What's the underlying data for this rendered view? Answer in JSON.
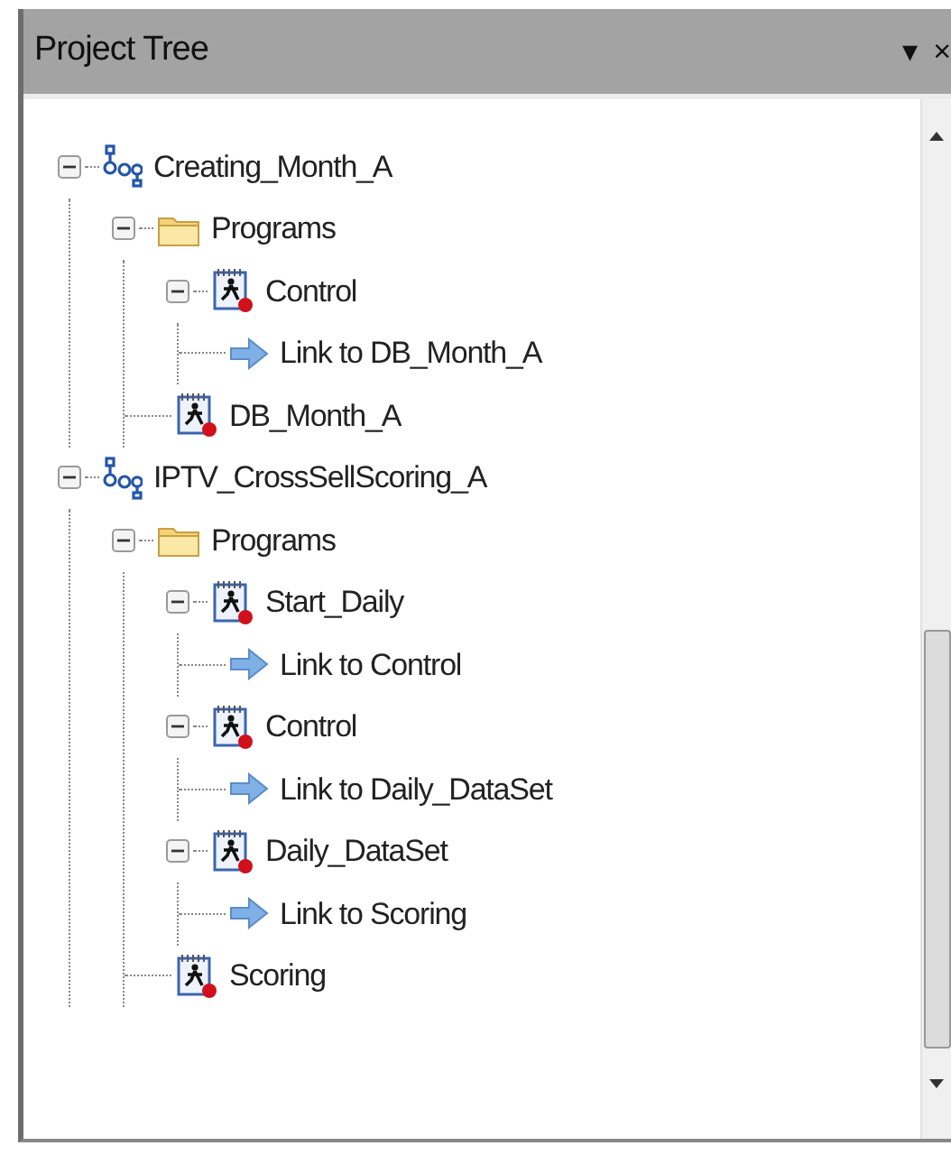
{
  "panel": {
    "title": "Project Tree",
    "menu_glyph": "▾",
    "close_glyph": "×"
  },
  "tree": [
    {
      "kind": "project",
      "label": "Creating_Month_A",
      "expanded": true,
      "children": [
        {
          "kind": "folder",
          "label": "Programs",
          "expanded": true,
          "children": [
            {
              "kind": "program",
              "label": "Control",
              "expanded": true,
              "children": [
                {
                  "kind": "link",
                  "label": "Link to DB_Month_A"
                }
              ]
            },
            {
              "kind": "program",
              "label": "DB_Month_A"
            }
          ]
        }
      ]
    },
    {
      "kind": "project",
      "label": "IPTV_CrossSellScoring_A",
      "expanded": true,
      "children": [
        {
          "kind": "folder",
          "label": "Programs",
          "expanded": true,
          "children": [
            {
              "kind": "program",
              "label": "Start_Daily",
              "expanded": true,
              "children": [
                {
                  "kind": "link",
                  "label": "Link to Control"
                }
              ]
            },
            {
              "kind": "program",
              "label": "Control",
              "expanded": true,
              "children": [
                {
                  "kind": "link",
                  "label": "Link to Daily_DataSet"
                }
              ]
            },
            {
              "kind": "program",
              "label": "Daily_DataSet",
              "expanded": true,
              "children": [
                {
                  "kind": "link",
                  "label": "Link to Scoring"
                }
              ]
            },
            {
              "kind": "program",
              "label": "Scoring"
            }
          ]
        }
      ]
    }
  ]
}
